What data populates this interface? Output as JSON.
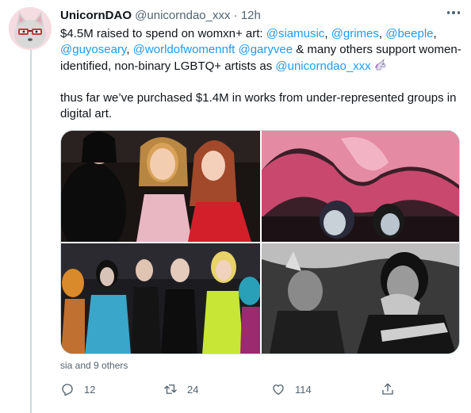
{
  "tweet": {
    "display_name": "UnicornDAO",
    "handle": "@unicorndao_xxx",
    "separator": "·",
    "time": "12h",
    "text": {
      "raised": "$4.5M raised to spend on womxn+ art: ",
      "m_siamusic": "@siamusic",
      "comma1": ", ",
      "m_grimes": "@grimes",
      "comma2": ", ",
      "m_beeple": "@beeple",
      "comma3": ",",
      "m_guyoseary": "@guyoseary",
      "comma4": ", ",
      "m_worldofwomennft": "@worldofwomennft",
      "space1": " ",
      "m_garyvee": "@garyvee",
      "support": " & many others support women-identified, non-binary  LGBTQ+ artists as ",
      "m_unicorndao": "@unicorndao_xxx",
      "para2": "thus far we’ve purchased $1.4M in works from under-represented groups in digital art."
    },
    "media_items": [
      "party-photo-1",
      "inflatable-photo-2",
      "crowd-photo-3",
      "bw-photo-4"
    ],
    "liked_by": "sia and 9 others",
    "actions": {
      "reply_count": "12",
      "retweet_count": "24",
      "like_count": "114"
    }
  },
  "colors": {
    "link": "#1d9bf0",
    "text": "#0f1419",
    "muted": "#536471",
    "border": "#cfd9de"
  },
  "icons": [
    "avatar-cat-icon",
    "more-icon",
    "unicorn-emoji",
    "reply-icon",
    "retweet-icon",
    "like-icon",
    "share-icon"
  ]
}
